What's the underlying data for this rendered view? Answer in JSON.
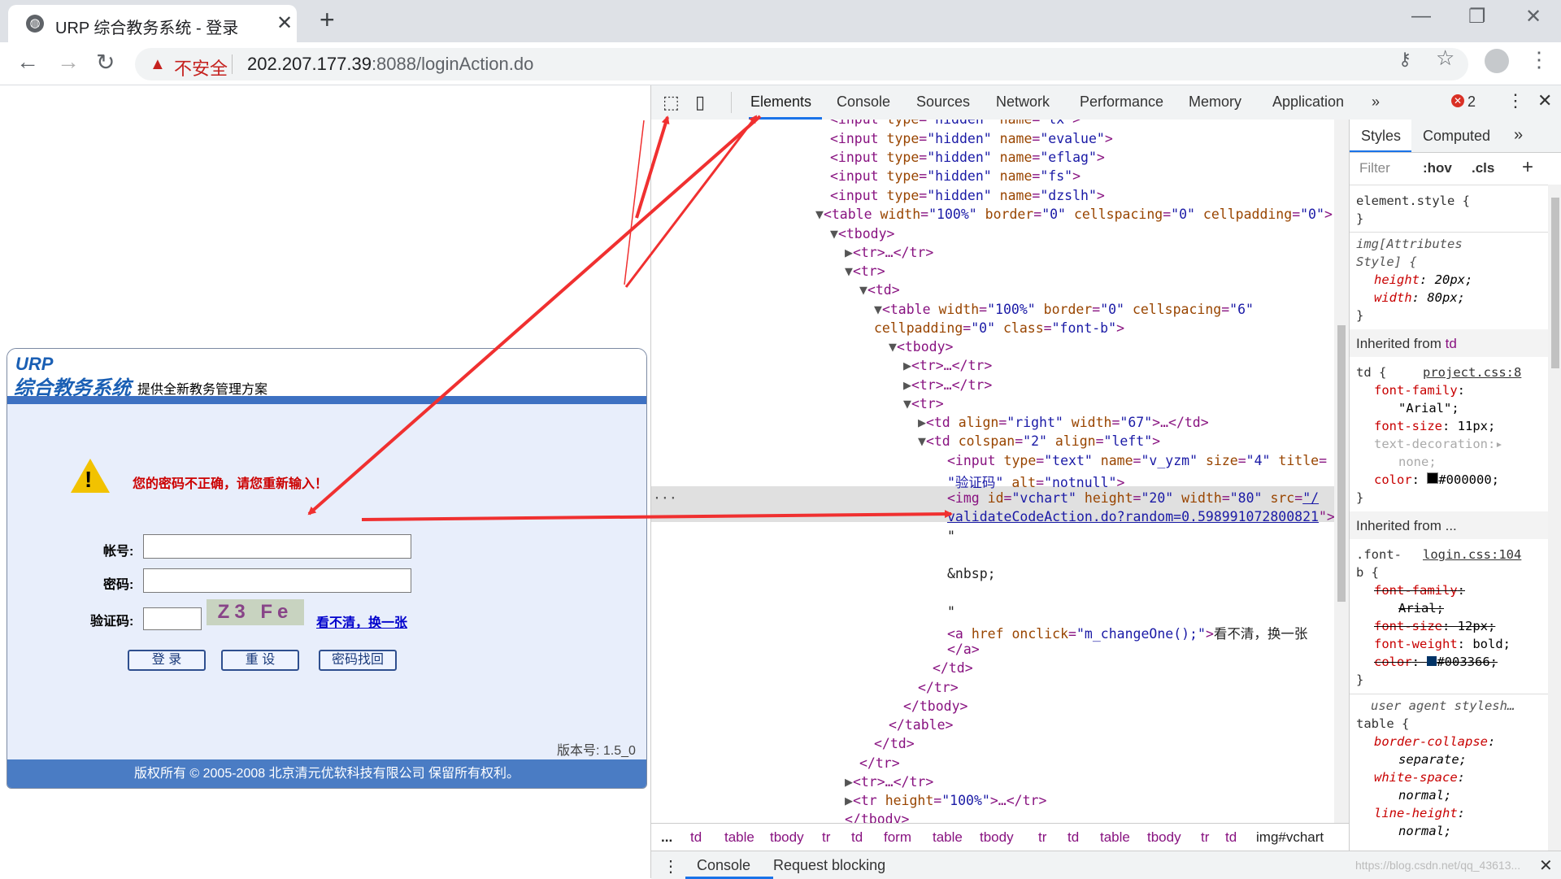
{
  "browser": {
    "tab_title": "URP 综合教务系统 - 登录",
    "security_label": "不安全",
    "url_host": "202.207.177.39",
    "url_rest": ":8088/loginAction.do"
  },
  "login_page": {
    "logo_urp": "URP",
    "logo_main": "综合教务系统",
    "slogan": "提供全新教务管理方案",
    "error_message": "您的密码不正确，请您重新输入！",
    "account_label": "帐号:",
    "password_label": "密码:",
    "captcha_label": "验证码:",
    "captcha_text": "Z3 Fe",
    "captcha_refresh_link": "看不清，换一张",
    "login_button": "登 录",
    "reset_button": "重 设",
    "recover_button": "密码找回",
    "version": "版本号: 1.5_0",
    "footer": "版权所有 © 2005-2008 北京清元优软科技有限公司 保留所有权利。"
  },
  "devtools": {
    "tabs": [
      "Elements",
      "Console",
      "Sources",
      "Network",
      "Performance",
      "Memory",
      "Application"
    ],
    "error_count": "2",
    "breadcrumbs": [
      "...",
      "td",
      "table",
      "tbody",
      "tr",
      "td",
      "form",
      "table",
      "tbody",
      "tr",
      "td",
      "table",
      "tbody",
      "tr",
      "td",
      "img#vchart"
    ],
    "drawer_tabs": [
      "Console",
      "Request blocking"
    ],
    "styles_tabs": [
      "Styles",
      "Computed"
    ],
    "filter_placeholder": "Filter",
    "hov_label": ":hov",
    "cls_label": ".cls",
    "inherited_td": "Inherited from ",
    "inherited_td_tag": "td",
    "inherited_more": "Inherited from ...",
    "watermark": "https://blog.csdn.net/qq_43613..."
  }
}
